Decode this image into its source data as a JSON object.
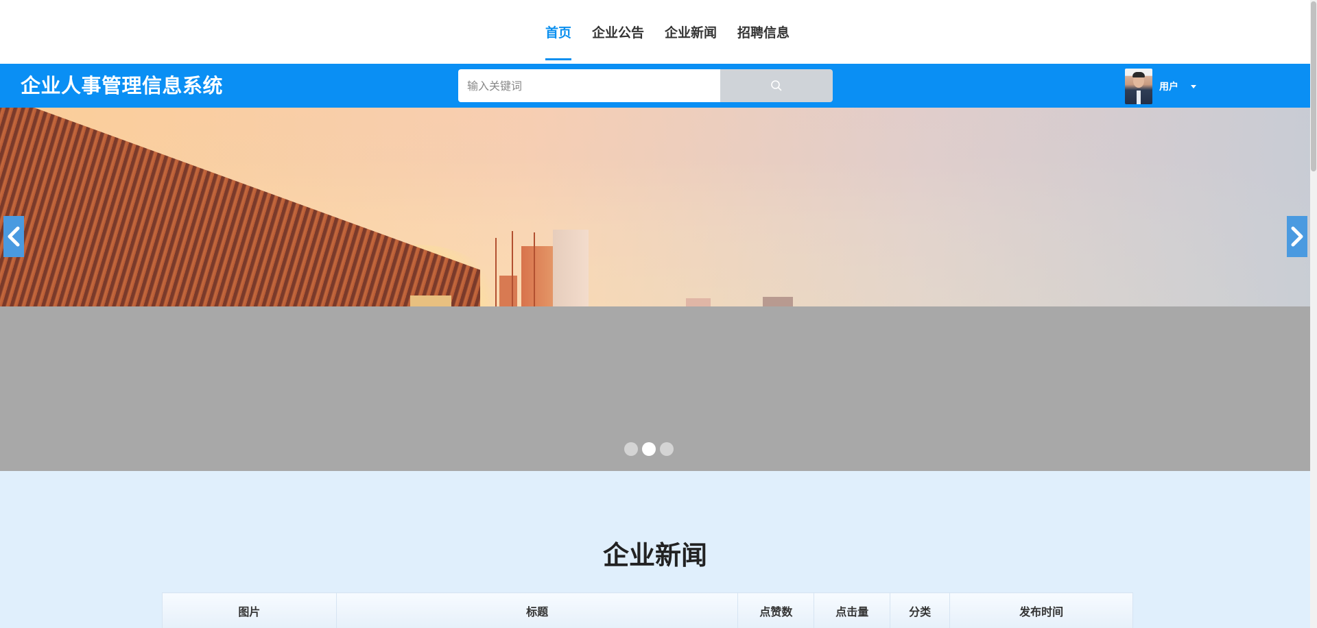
{
  "nav": {
    "items": [
      {
        "label": "首页",
        "active": true
      },
      {
        "label": "企业公告",
        "active": false
      },
      {
        "label": "企业新闻",
        "active": false
      },
      {
        "label": "招聘信息",
        "active": false
      }
    ]
  },
  "header": {
    "logo": "企业人事管理信息系统",
    "search": {
      "placeholder": "输入关键词",
      "value": ""
    },
    "user": {
      "name": "用户"
    }
  },
  "carousel": {
    "slide_count": 3,
    "active_index": 1
  },
  "news": {
    "title": "企业新闻",
    "columns": [
      "图片",
      "标题",
      "点赞数",
      "点击量",
      "分类",
      "发布时间"
    ]
  },
  "colors": {
    "brand_blue": "#0a8ff4",
    "nav_active": "#0a8fef",
    "section_bg": "#e0effc"
  }
}
